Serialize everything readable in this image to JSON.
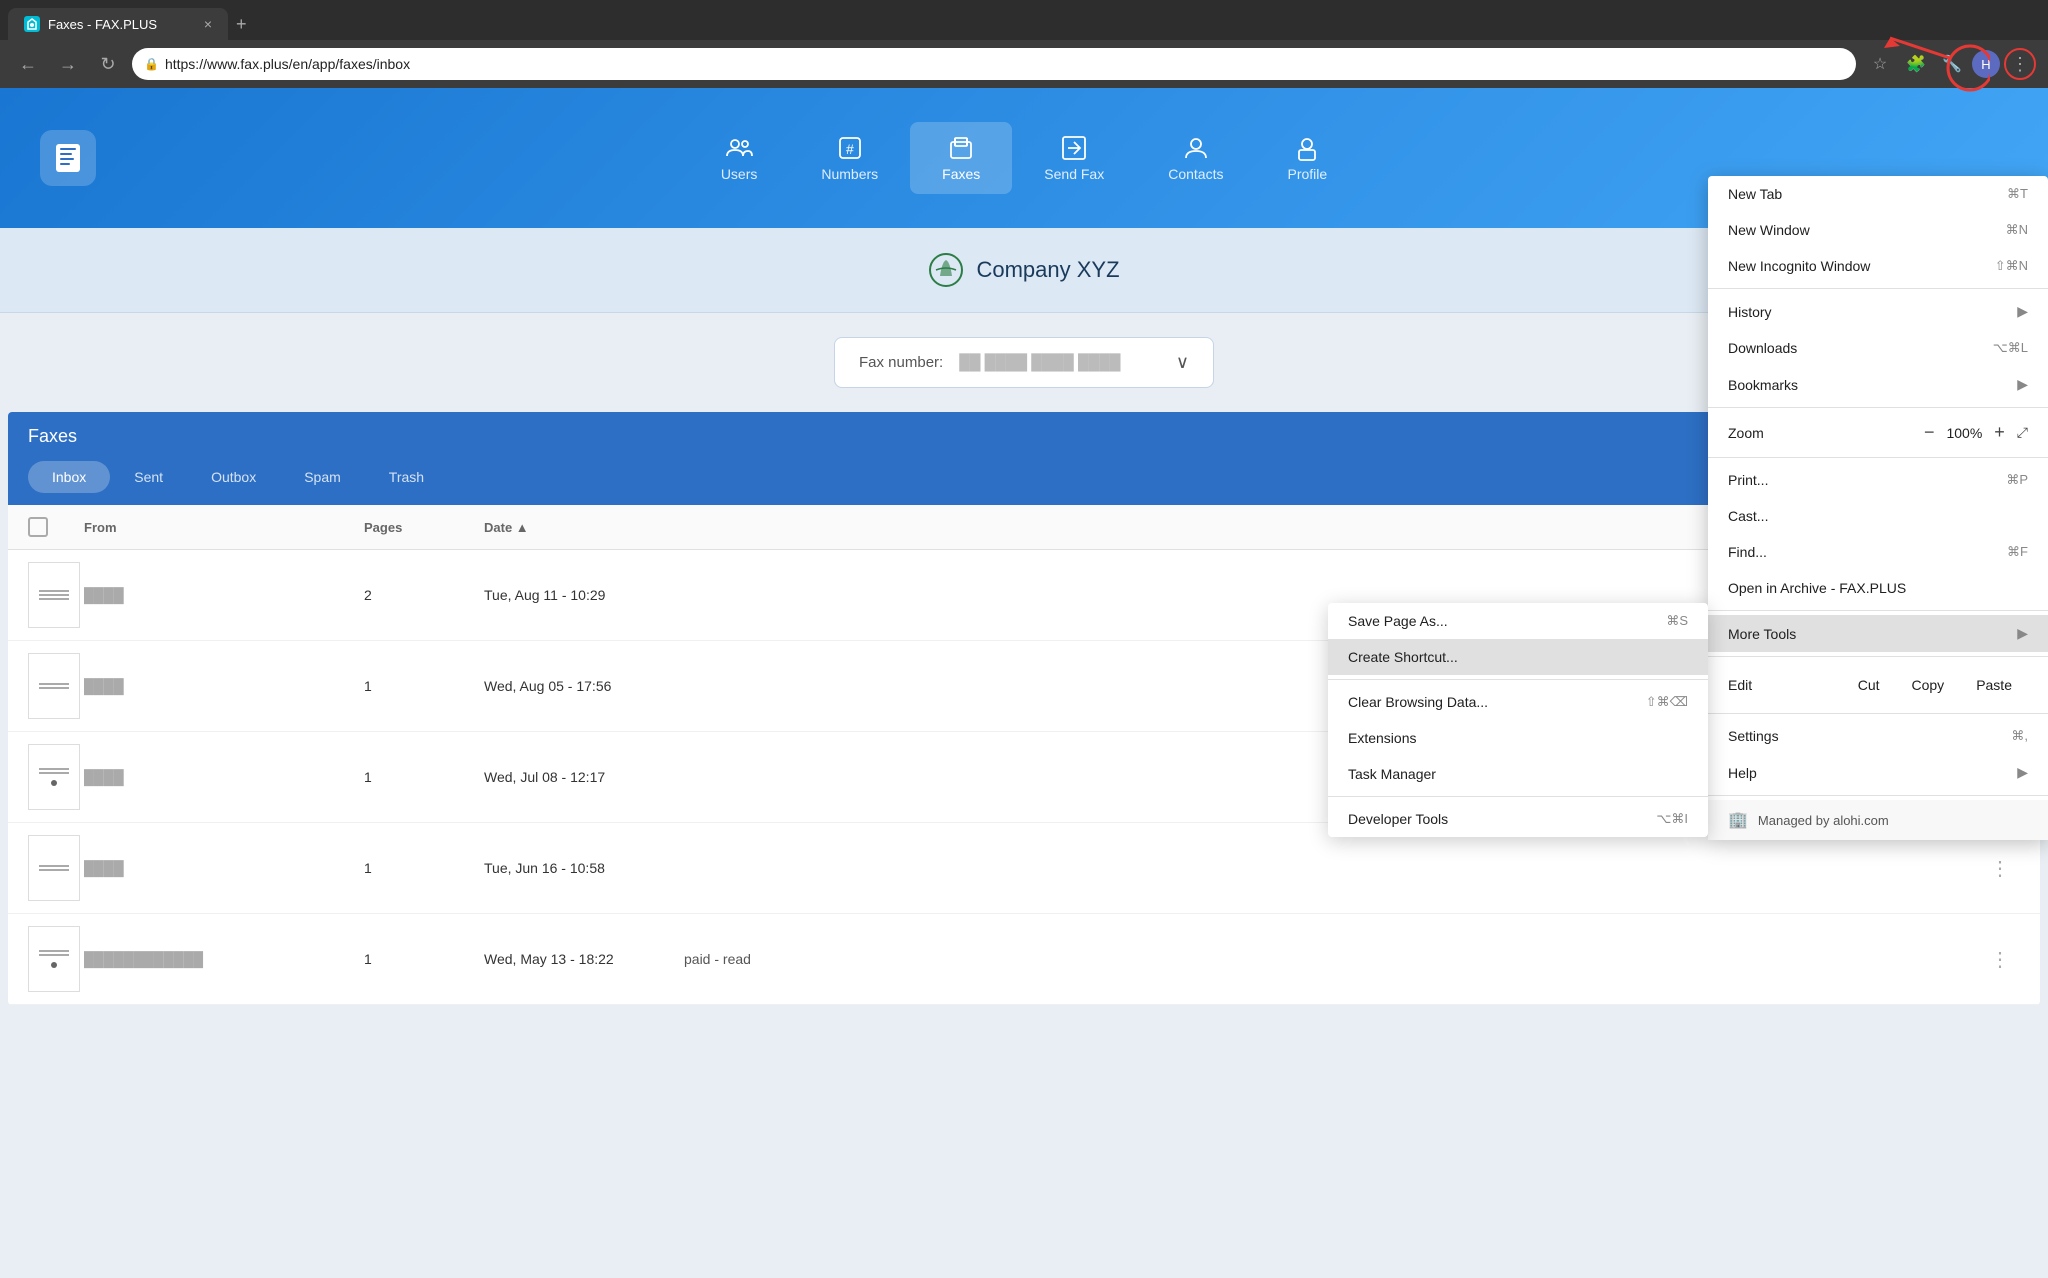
{
  "browser": {
    "tab_title": "Faxes - FAX.PLUS",
    "tab_close": "×",
    "tab_new": "+",
    "url": "https://www.fax.plus/en/app/faxes/inbox",
    "nav_back": "←",
    "nav_forward": "→",
    "nav_reload": "↻"
  },
  "context_menu": {
    "items": [
      {
        "label": "New Tab",
        "shortcut": "⌘T",
        "has_arrow": false
      },
      {
        "label": "New Window",
        "shortcut": "⌘N",
        "has_arrow": false
      },
      {
        "label": "New Incognito Window",
        "shortcut": "⇧⌘N",
        "has_arrow": false
      },
      {
        "divider": true
      },
      {
        "label": "History",
        "shortcut": "",
        "has_arrow": true
      },
      {
        "label": "Downloads",
        "shortcut": "⌥⌘L",
        "has_arrow": false
      },
      {
        "label": "Bookmarks",
        "shortcut": "",
        "has_arrow": true
      },
      {
        "divider": true
      },
      {
        "label": "Zoom",
        "is_zoom": true,
        "zoom_minus": "−",
        "zoom_value": "100%",
        "zoom_plus": "+",
        "zoom_fullscreen": "⤢"
      },
      {
        "divider": true
      },
      {
        "label": "Print...",
        "shortcut": "⌘P",
        "has_arrow": false
      },
      {
        "label": "Cast...",
        "shortcut": "",
        "has_arrow": false
      },
      {
        "label": "Find...",
        "shortcut": "⌘F",
        "has_arrow": false
      },
      {
        "label": "Open in Archive - FAX.PLUS",
        "shortcut": "",
        "has_arrow": false
      },
      {
        "divider": true
      },
      {
        "label": "More Tools",
        "shortcut": "",
        "has_arrow": true,
        "highlighted": false
      },
      {
        "divider": true
      },
      {
        "is_edit_row": true,
        "label": "Edit",
        "cut": "Cut",
        "copy": "Copy",
        "paste": "Paste"
      },
      {
        "divider": true
      },
      {
        "label": "Settings",
        "shortcut": "⌘,",
        "has_arrow": false
      },
      {
        "label": "Help",
        "shortcut": "",
        "has_arrow": true
      },
      {
        "divider": true
      },
      {
        "is_managed": true,
        "icon": "🏢",
        "text": "Managed by alohi.com"
      }
    ]
  },
  "submenu": {
    "items": [
      {
        "label": "Save Page As...",
        "shortcut": "⌘S"
      },
      {
        "label": "Create Shortcut...",
        "shortcut": "",
        "highlighted": true
      },
      {
        "divider": true
      },
      {
        "label": "Clear Browsing Data...",
        "shortcut": "⇧⌘⌫"
      },
      {
        "label": "Extensions",
        "shortcut": ""
      },
      {
        "label": "Task Manager",
        "shortcut": ""
      },
      {
        "divider": true
      },
      {
        "label": "Developer Tools",
        "shortcut": "⌥⌘I"
      }
    ]
  },
  "app": {
    "nav_tabs": [
      {
        "id": "users",
        "label": "Users"
      },
      {
        "id": "numbers",
        "label": "Numbers"
      },
      {
        "id": "faxes",
        "label": "Faxes",
        "active": true
      },
      {
        "id": "send-fax",
        "label": "Send Fax"
      },
      {
        "id": "contacts",
        "label": "Contacts"
      },
      {
        "id": "profile",
        "label": "Profile"
      }
    ],
    "company_name": "Company XYZ",
    "fax_number_label": "Fax number:",
    "fax_number_value": "██ ████ ████ ████"
  },
  "faxes": {
    "title": "Faxes",
    "tabs": [
      {
        "label": "Inbox",
        "active": true
      },
      {
        "label": "Sent",
        "active": false
      },
      {
        "label": "Outbox",
        "active": false
      },
      {
        "label": "Spam",
        "active": false
      },
      {
        "label": "Trash",
        "active": false
      }
    ],
    "columns": [
      "",
      "From",
      "Pages",
      "Date",
      "",
      ""
    ],
    "rows": [
      {
        "pages": "2",
        "date": "Tue, Aug 11 - 10:29",
        "status": ""
      },
      {
        "pages": "1",
        "date": "Wed, Aug 05 - 17:56",
        "status": ""
      },
      {
        "pages": "1",
        "date": "Wed, Jul 08 - 12:17",
        "status": ""
      },
      {
        "pages": "1",
        "date": "Tue, Jun 16 - 10:58",
        "status": ""
      },
      {
        "pages": "1",
        "date": "Wed, May 13 - 18:22",
        "status": "paid - read"
      }
    ]
  }
}
